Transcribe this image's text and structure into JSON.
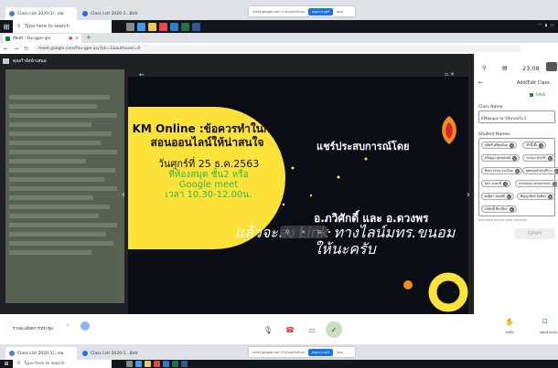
{
  "top_tabs": [
    {
      "label": "Class List 2020-1l...ew",
      "color": "#4a7fd4"
    },
    {
      "label": "Class List 2020-1...8ntr",
      "color": "#1a73e8"
    }
  ],
  "share_banner": {
    "text": "meet.google.com กำลังแชร์หน้าจอ",
    "stop_label": "หยุดการแชร์",
    "hide_label": "ซ่อน"
  },
  "taskbar": {
    "search_placeholder": "Type here to search"
  },
  "browser": {
    "tab_title": "Meet - fxu-gpe-ipv",
    "address": "meet.google.com/fxu-gpe-ipv?pli=1&authuser=0"
  },
  "meet": {
    "presenter_label": "คุณกำลังนำเสนอ",
    "slide": {
      "title_line1": "KM Online :ข้อควรทำในการ",
      "title_line2": "สอนออนไลน์ให้น่าสนใจ",
      "date_line": "วันศุกร์ที่ 25 ธ.ค.2563",
      "place_line1": "ที่ห้องสมุด ชั้น2 หรือ",
      "place_line2": "Google meet",
      "time_line": "เวลา 10.30-12.00น.",
      "share_text": "แชร์ประสบการณ์โดย",
      "teachers": "อ.ภวิศักดิ์ และ อ.ดวงพร",
      "script_line1": "แล้วจะส่ง Link ทางไลน์มทร.ขนอม",
      "script_line2": "ให้นะครับ"
    },
    "bottom_label": "รายละเอียดการประชุม"
  },
  "panel": {
    "time": "23:08",
    "back_label": "←",
    "title": "Add/Edit Class",
    "save_label": "SAVE",
    "class_name_label": "Class Name",
    "class_name_value": "KMชุมนุมภาษาให้น่าสนใจ 2",
    "student_names_label": "Student Names",
    "students": [
      "ปพิตรี ศรีสุขข้อม",
      "วิริ ผึ้งผึ้ง",
      "ปริญญา สุทรศรดย์",
      "วรรณา ทรงวิร์",
      "ศิรดาวรรณ รวมโยม",
      "ยุทธมนต์ ทรงมีราว",
      "สุชา อาคาดี",
      "บรรณดนา ตรงธรรมกร",
      "พงฐิตา รพงษ์ดี",
      "ศิญญาพิตร์ ยิ่งตีตร",
      "ภวิศักดิ์ ทีมาฝึกร"
    ],
    "helper_text": "Separate names with commas",
    "export_label": "EXPORT"
  },
  "bottom_controls": {
    "raise_hand": "ยกมือ",
    "present": "หยุดนำเสนอ"
  }
}
